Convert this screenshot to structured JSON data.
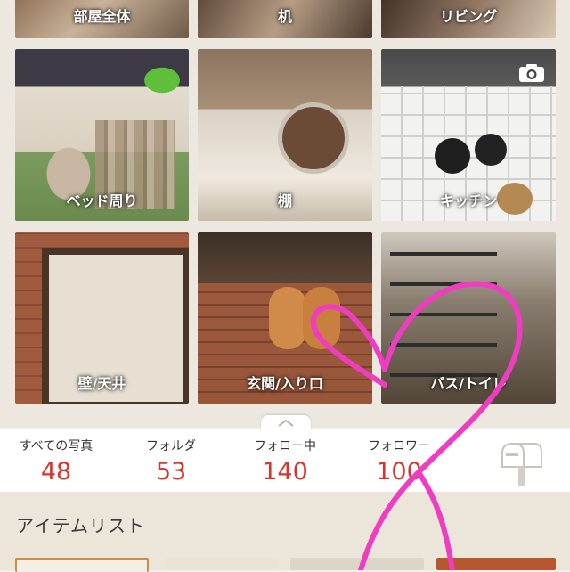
{
  "categories": [
    {
      "label": "部屋全体"
    },
    {
      "label": "机"
    },
    {
      "label": "リビング"
    },
    {
      "label": "ベッド周り"
    },
    {
      "label": "棚"
    },
    {
      "label": "キッチン"
    },
    {
      "label": "壁/天井"
    },
    {
      "label": "玄関/入り口"
    },
    {
      "label": "バス/トイレ"
    }
  ],
  "stats": [
    {
      "label": "すべての写真",
      "value": "48"
    },
    {
      "label": "フォルダ",
      "value": "53"
    },
    {
      "label": "フォロー中",
      "value": "140"
    },
    {
      "label": "フォロワー",
      "value": "100"
    }
  ],
  "items": {
    "title": "アイテムリスト"
  },
  "icons": {
    "camera": "camera-icon",
    "collapse": "chevron-up-icon",
    "mailbox": "mailbox-icon"
  },
  "colors": {
    "stat_value": "#d9342b",
    "heart_drawing": "#f03cc0"
  }
}
